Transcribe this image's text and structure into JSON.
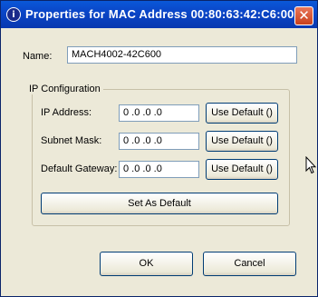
{
  "window": {
    "title": "Properties for MAC Address 00:80:63:42:C6:00",
    "app_icon": "info-icon",
    "close_glyph": "✕"
  },
  "form": {
    "name_label": "Name:",
    "name_value": "MACH4002-42C600",
    "ip_config": {
      "title": "IP Configuration",
      "ip_address_label": "IP Address:",
      "ip_address_value": "0 .0 .0 .0",
      "subnet_mask_label": "Subnet Mask:",
      "subnet_mask_value": "0 .0 .0 .0",
      "default_gateway_label": "Default Gateway:",
      "default_gateway_value": "0 .0 .0 .0",
      "use_default_label": "Use Default ()",
      "set_as_default_label": "Set As Default"
    }
  },
  "actions": {
    "ok_label": "OK",
    "cancel_label": "Cancel"
  },
  "colors": {
    "titlebar": "#0a46c8",
    "dialog_background": "#ece9d8",
    "close_button": "#d4542e",
    "field_border": "#7f9db9"
  }
}
